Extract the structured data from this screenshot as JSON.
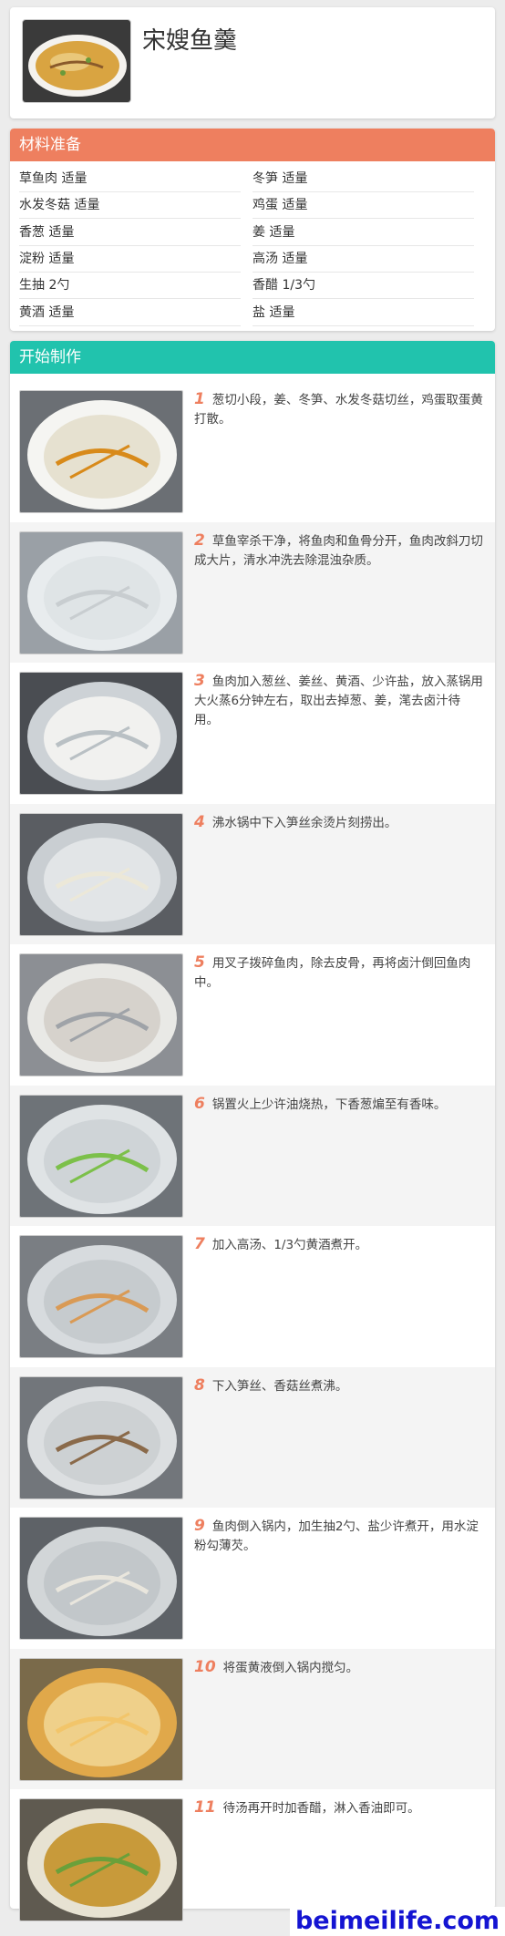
{
  "recipe": {
    "title": "宋嫂鱼羹"
  },
  "ingredients": {
    "header": "材料准备",
    "items": [
      {
        "name": "草鱼肉",
        "amount": "适量"
      },
      {
        "name": "冬笋",
        "amount": "适量"
      },
      {
        "name": "水发冬菇",
        "amount": "适量"
      },
      {
        "name": "鸡蛋",
        "amount": "适量"
      },
      {
        "name": "香葱",
        "amount": "适量"
      },
      {
        "name": "姜",
        "amount": "适量"
      },
      {
        "name": "淀粉",
        "amount": "适量"
      },
      {
        "name": "高汤",
        "amount": "适量"
      },
      {
        "name": "生抽",
        "amount": "2勺"
      },
      {
        "name": "香醋",
        "amount": "1/3勺"
      },
      {
        "name": "黄酒",
        "amount": "适量"
      },
      {
        "name": "盐",
        "amount": "适量"
      }
    ]
  },
  "steps": {
    "header": "开始制作",
    "items": [
      {
        "num": "1",
        "text": "葱切小段，姜、冬笋、水发冬菇切丝，鸡蛋取蛋黄打散。"
      },
      {
        "num": "2",
        "text": "草鱼宰杀干净，将鱼肉和鱼骨分开，鱼肉改斜刀切成大片，清水冲洗去除混浊杂质。"
      },
      {
        "num": "3",
        "text": "鱼肉加入葱丝、姜丝、黄酒、少许盐，放入蒸锅用大火蒸6分钟左右，取出去掉葱、姜，滗去卤汁待用。"
      },
      {
        "num": "4",
        "text": "沸水锅中下入笋丝余烫片刻捞出。"
      },
      {
        "num": "5",
        "text": "用叉子拨碎鱼肉，除去皮骨，再将卤汁倒回鱼肉中。"
      },
      {
        "num": "6",
        "text": "锅置火上少许油烧热，下香葱煸至有香味。"
      },
      {
        "num": "7",
        "text": "加入高汤、1/3勺黄酒煮开。"
      },
      {
        "num": "8",
        "text": "下入笋丝、香菇丝煮沸。"
      },
      {
        "num": "9",
        "text": "鱼肉倒入锅内，加生抽2勺、盐少许煮开，用水淀粉勾薄芡。"
      },
      {
        "num": "10",
        "text": "将蛋黄液倒入锅内搅匀。"
      },
      {
        "num": "11",
        "text": "待汤再开时加香醋，淋入香油即可。"
      }
    ]
  },
  "watermark": "beimeilife.com"
}
